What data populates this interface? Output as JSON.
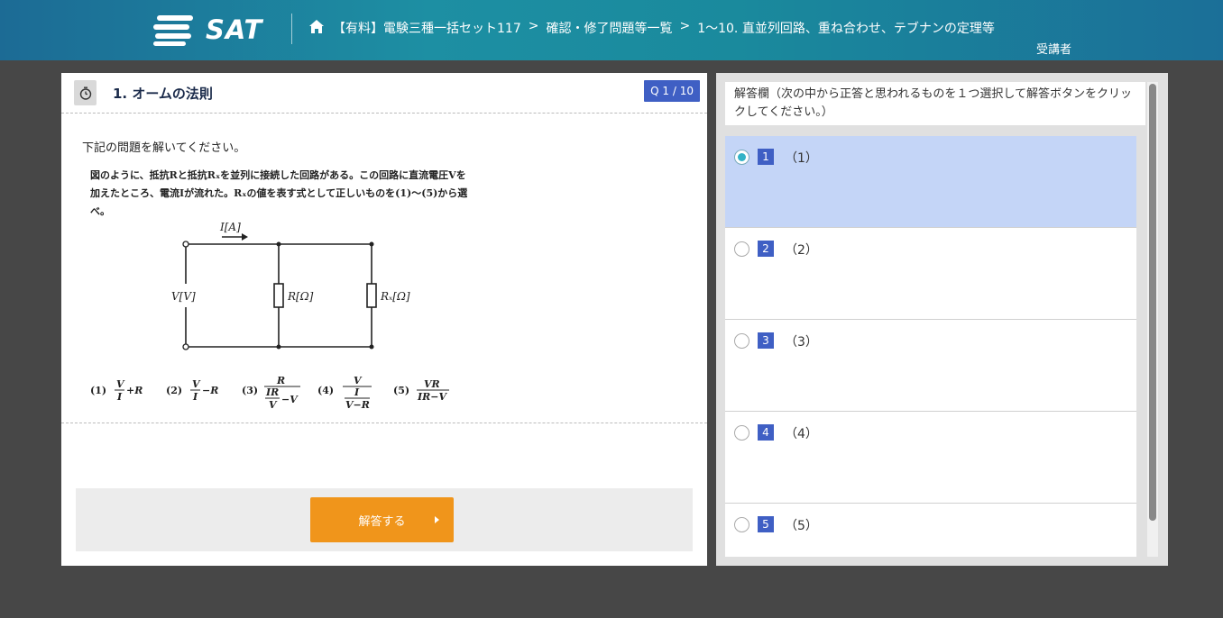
{
  "header": {
    "logo_text": "SAT",
    "breadcrumb": [
      "【有料】電験三種一括セット117",
      "確認・修了問題等一覧",
      "1〜10. 直並列回路、重ね合わせ、テブナンの定理等"
    ],
    "separator": ">",
    "user_label": "受講者",
    "colors": {
      "gradient_start": "#1c6b95",
      "gradient_mid": "#1d8fa3",
      "gradient_end": "#1b6f98"
    }
  },
  "question": {
    "title": "1. オームの法則",
    "counter": "Q 1 / 10",
    "instruction": "下記の問題を解いてください。",
    "text_line1": "図のように、抵抗Rと抵抗Rₓを並列に接続した回路がある。この回路に直流電圧Vを",
    "text_line2": "加えたところ、電流Iが流れた。Rₓの値を表す式として正しいものを(1)〜(5)から選",
    "text_line3": "べ。",
    "circuit": {
      "current_label": "I[A]",
      "voltage_label": "V[V]",
      "r_label": "R[Ω]",
      "rx_label": "Rₓ[Ω]"
    },
    "choices": {
      "c1_num": "(1)",
      "c1_a": "V",
      "c1_b": "I",
      "c1_c": "+R",
      "c2_num": "(2)",
      "c2_a": "V",
      "c2_b": "I",
      "c2_c": "−R",
      "c3_num": "(3)",
      "c3_a": "R",
      "c3_b": "IR",
      "c3_c": "V",
      "c3_d": "−V",
      "c4_num": "(4)",
      "c4_a": "V",
      "c4_b": "I",
      "c4_c": "V−R",
      "c5_num": "(5)",
      "c5_a": "VR",
      "c5_b": "IR−V"
    },
    "answer_button": "解答する"
  },
  "answer_panel": {
    "header": "解答欄（次の中から正答と思われるものを１つ選択して解答ボタンをクリックしてください。）",
    "options": [
      {
        "num": "1",
        "label": "（1）",
        "selected": true
      },
      {
        "num": "2",
        "label": "（2）",
        "selected": false
      },
      {
        "num": "3",
        "label": "（3）",
        "selected": false
      },
      {
        "num": "4",
        "label": "（4）",
        "selected": false
      },
      {
        "num": "5",
        "label": "（5）",
        "selected": false
      }
    ],
    "colors": {
      "selected_bg": "#c4d5f7",
      "badge": "#3f5fc4",
      "radio_dot": "#33b3c7",
      "button": "#f0951b"
    }
  }
}
